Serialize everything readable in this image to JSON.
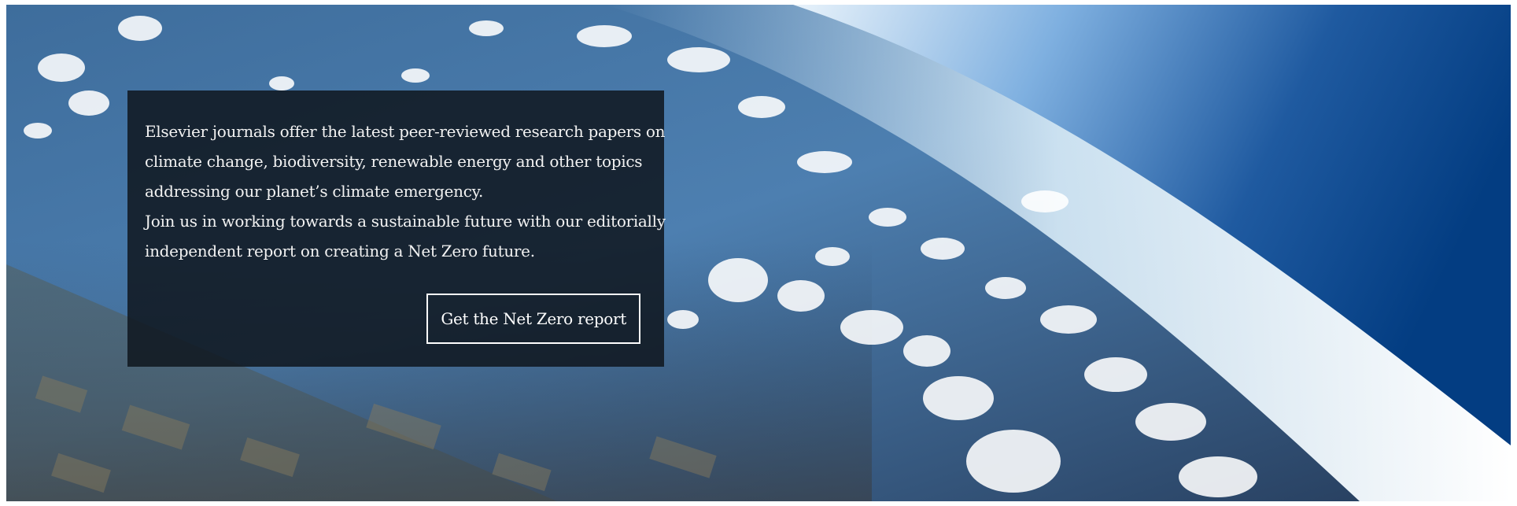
{
  "hero": {
    "text_lines": [
      "Elsevier journals offer the latest peer-reviewed research papers on",
      "climate change, biodiversity, renewable energy and other topics",
      "addressing our planet’s climate emergency.",
      "Join us in working towards a sustainable future with our editorially",
      "independent report on creating a Net Zero future."
    ],
    "button_label": "Get the Net Zero report"
  }
}
